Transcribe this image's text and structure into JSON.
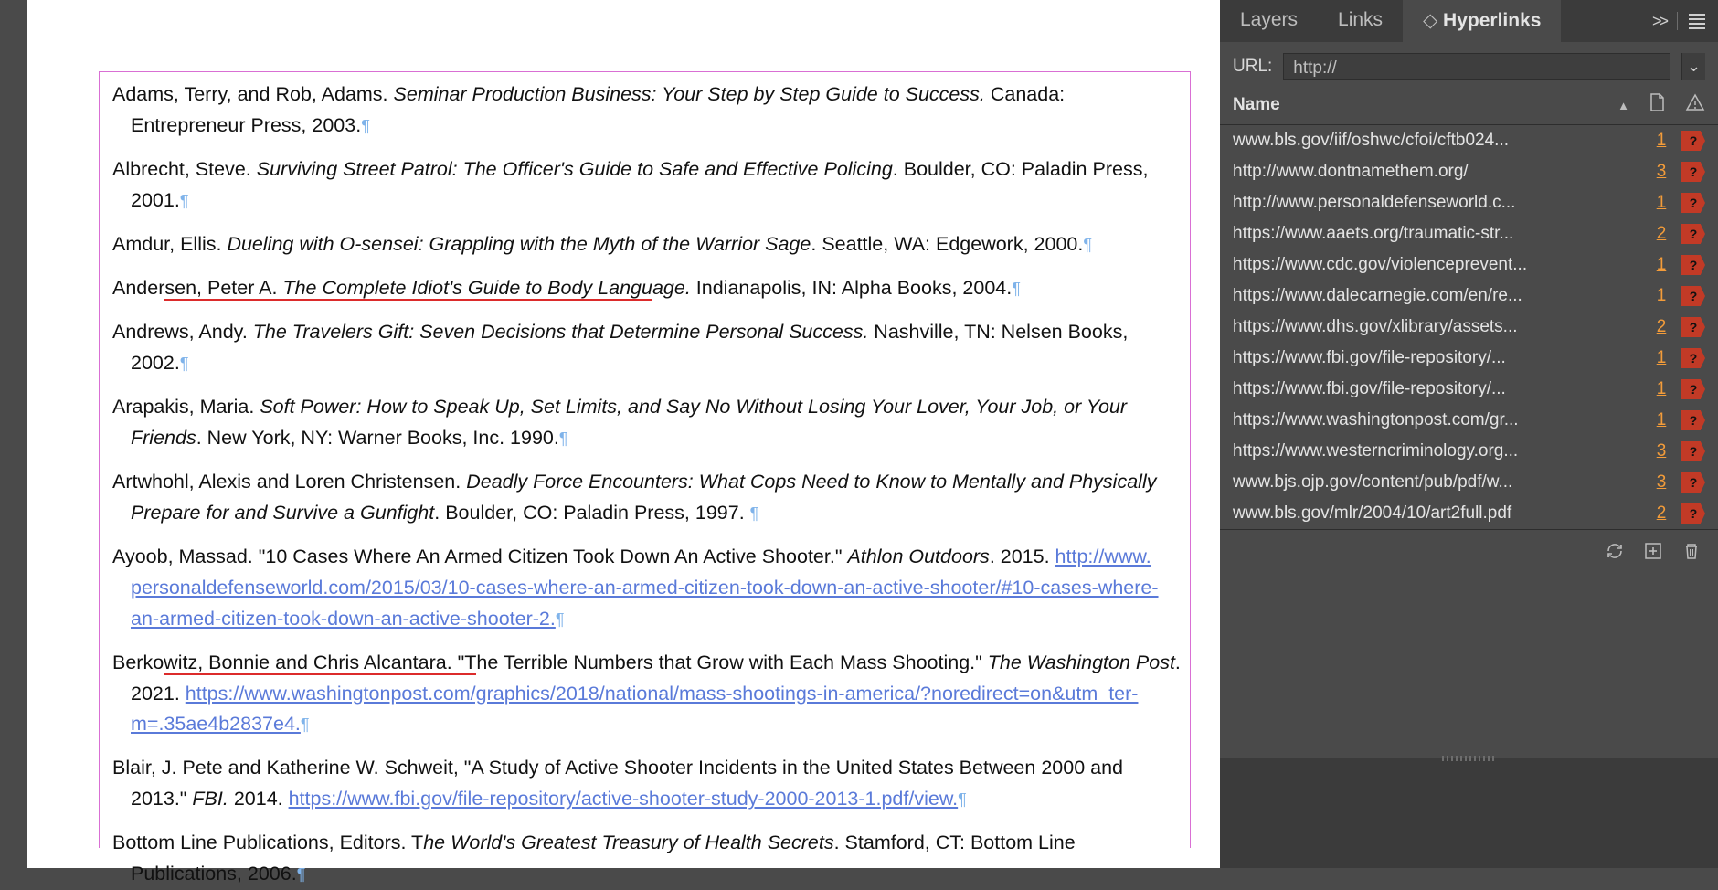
{
  "panel": {
    "tabs": {
      "layers": "Layers",
      "links": "Links",
      "hyperlinks": "Hyperlinks"
    },
    "more_icon": ">>",
    "url_label": "URL:",
    "url_value": "http://",
    "header_name": "Name",
    "footer": {
      "refresh": "refresh",
      "add": "add",
      "trash": "trash"
    },
    "rows": [
      {
        "text": "www.bls.gov/iif/oshwc/cfoi/cftb024...",
        "page": "1",
        "status": "?"
      },
      {
        "text": "http://www.dontnamethem.org/",
        "page": "3",
        "status": "?"
      },
      {
        "text": "http://www.personaldefenseworld.c...",
        "page": "1",
        "status": "?"
      },
      {
        "text": "https://www.aaets.org/traumatic-str...",
        "page": "2",
        "status": "?"
      },
      {
        "text": "https://www.cdc.gov/violenceprevent...",
        "page": "1",
        "status": "?"
      },
      {
        "text": "https://www.dalecarnegie.com/en/re...",
        "page": "1",
        "status": "?"
      },
      {
        "text": "https://www.dhs.gov/xlibrary/assets...",
        "page": "2",
        "status": "?"
      },
      {
        "text": "https://www.fbi.gov/file-repository/...",
        "page": "1",
        "status": "?"
      },
      {
        "text": "https://www.fbi.gov/file-repository/...",
        "page": "1",
        "status": "?"
      },
      {
        "text": "https://www.washingtonpost.com/gr...",
        "page": "1",
        "status": "?"
      },
      {
        "text": "https://www.westerncriminology.org...",
        "page": "3",
        "status": "?"
      },
      {
        "text": "www.bjs.ojp.gov/content/pub/pdf/w...",
        "page": "3",
        "status": "?"
      },
      {
        "text": "www.bls.gov/mlr/2004/10/art2full.pdf",
        "page": "2",
        "status": "?"
      }
    ]
  },
  "doc": {
    "pilcrow": "¶",
    "e1": {
      "a": "Adams, Terry, and Rob, Adams. ",
      "t": "Seminar Production Business: Your Step by Step Guide to Success.",
      "b": " Canada: Entrepreneur Press, 2003."
    },
    "e2": {
      "a": "Albrecht, Steve. ",
      "t": "Surviving Street Patrol: The Officer's Guide to Safe and Effective Policing",
      "b": ". Boulder, CO: Paladin Press, 2001."
    },
    "e3": {
      "a": "Amdur, Ellis. ",
      "t": "Dueling with O-sensei: Grappling with the Myth of the Warrior Sage",
      "b": ". Seattle, WA: Edgework, 2000."
    },
    "e4": {
      "pre": "Ander",
      "red": "sen, Peter A. ",
      "redItalic": "The Complete Idiot's Guide to Body Langu",
      "postItalic": "age.",
      "post": " Indianapolis, IN: Alpha Books, 2004."
    },
    "e5": {
      "a": "Andrews, Andy. ",
      "t": "The Travelers Gift: Seven Decisions that Determine Personal Success.",
      "b": " Nashville, TN: Nelsen Books, 2002."
    },
    "e6": {
      "a": "Arapakis, Maria. ",
      "t": "Soft Power: How to Speak Up, Set Limits, and Say No Without Losing Your Lover, Your Job, or Your Friends",
      "b": ". New York, NY: Warner Books, Inc. 1990."
    },
    "e7": {
      "a": "Artwhohl, Alexis and Loren Christensen. ",
      "t": "Deadly Force Encounters: What Cops Need to Know to Mentally and Physically Prepare for and Survive a Gunfight",
      "b": ". Boulder, CO: Paladin Press, 1997. "
    },
    "e8": {
      "a": "Ayoob, Massad. \"10 Cases Where An Armed Citizen Took Down An Active Shooter.\" ",
      "t": "Athlon Outdoors",
      "b": ". 2015. ",
      "l1": "http://www.",
      "l2": "personaldefenseworld.com/2015/03/10-cases-where-an-armed-citizen-took-down-an-active-shooter/#10-cases-where-",
      "l3": "an-armed-citizen-took-down-an-active-shooter-2."
    },
    "e9": {
      "pre": "Berko",
      "red": "witz, Bonnie and Chris Alcantara. \"T",
      "post": "he Terrible Numbers that Grow with Each Mass Shooting.\" ",
      "t": "The Washington Post",
      "b": ". 2021. ",
      "l1": "https://www.washingtonpost.com/graphics/2018/national/mass-shootings-in-america/?noredirect=on&utm_ter-",
      "l2": "m=.35ae4b2837e4."
    },
    "e10": {
      "a": "Blair, J. Pete and Katherine W. Schweit, \"A Study of Active Shooter Incidents in the United States Between 2000 and 2013.\" ",
      "t": "FBI.",
      "b": " 2014. ",
      "l1": "https://www.fbi.gov/file-repository/active-shooter-study-2000-2013-1.pdf/view."
    },
    "e11": {
      "a": "Bottom Line Publications, Editors. T",
      "t": "he World's Greatest Treasury of Health Secrets",
      "b": ". Stamford, CT: Bottom Line Publications, 2006."
    }
  }
}
